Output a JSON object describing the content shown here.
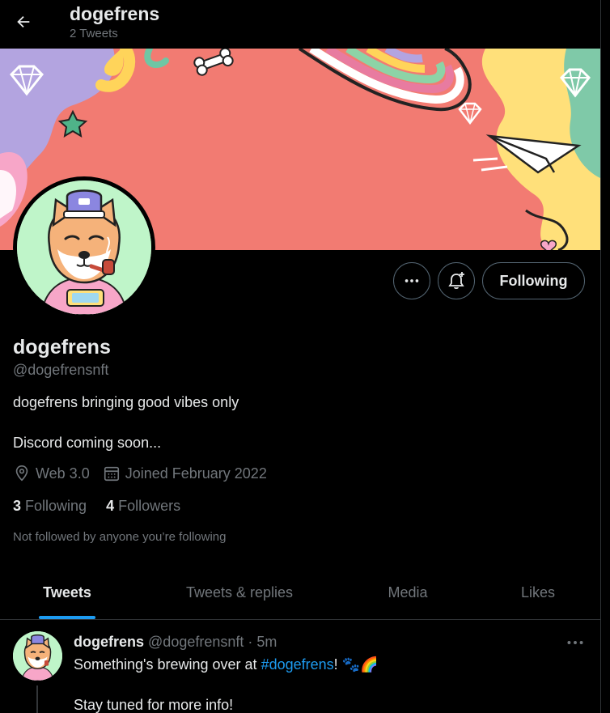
{
  "header": {
    "title": "dogefrens",
    "subtitle": "2 Tweets",
    "back_icon": "arrow-left-icon"
  },
  "profile": {
    "display_name": "dogefrens",
    "handle": "@dogefrensnft",
    "bio_line1": "dogefrens bringing good vibes only",
    "bio_line2": "Discord coming soon...",
    "location": "Web 3.0",
    "joined": "Joined February 2022",
    "following_count": "3",
    "following_label": "Following",
    "followers_count": "4",
    "followers_label": "Followers",
    "not_followed_note": "Not followed by anyone you’re following"
  },
  "actions": {
    "more_icon": "more-dots-icon",
    "notify_icon": "bell-plus-icon",
    "follow_label": "Following"
  },
  "tabs": [
    {
      "label": "Tweets",
      "active": true
    },
    {
      "label": "Tweets & replies",
      "active": false
    },
    {
      "label": "Media",
      "active": false
    },
    {
      "label": "Likes",
      "active": false
    }
  ],
  "tweet": {
    "name": "dogefrens",
    "handle": "@dogefrensnft",
    "separator": "·",
    "time": "5m",
    "text_before": "Something's brewing over at ",
    "hashtag": "#dogefrens",
    "text_after": "! 🐾🌈",
    "line2": "Stay tuned for more info!"
  },
  "colors": {
    "background": "#000000",
    "accent": "#1d9bf0",
    "muted": "#71767b",
    "banner_base": "#f27b72"
  }
}
